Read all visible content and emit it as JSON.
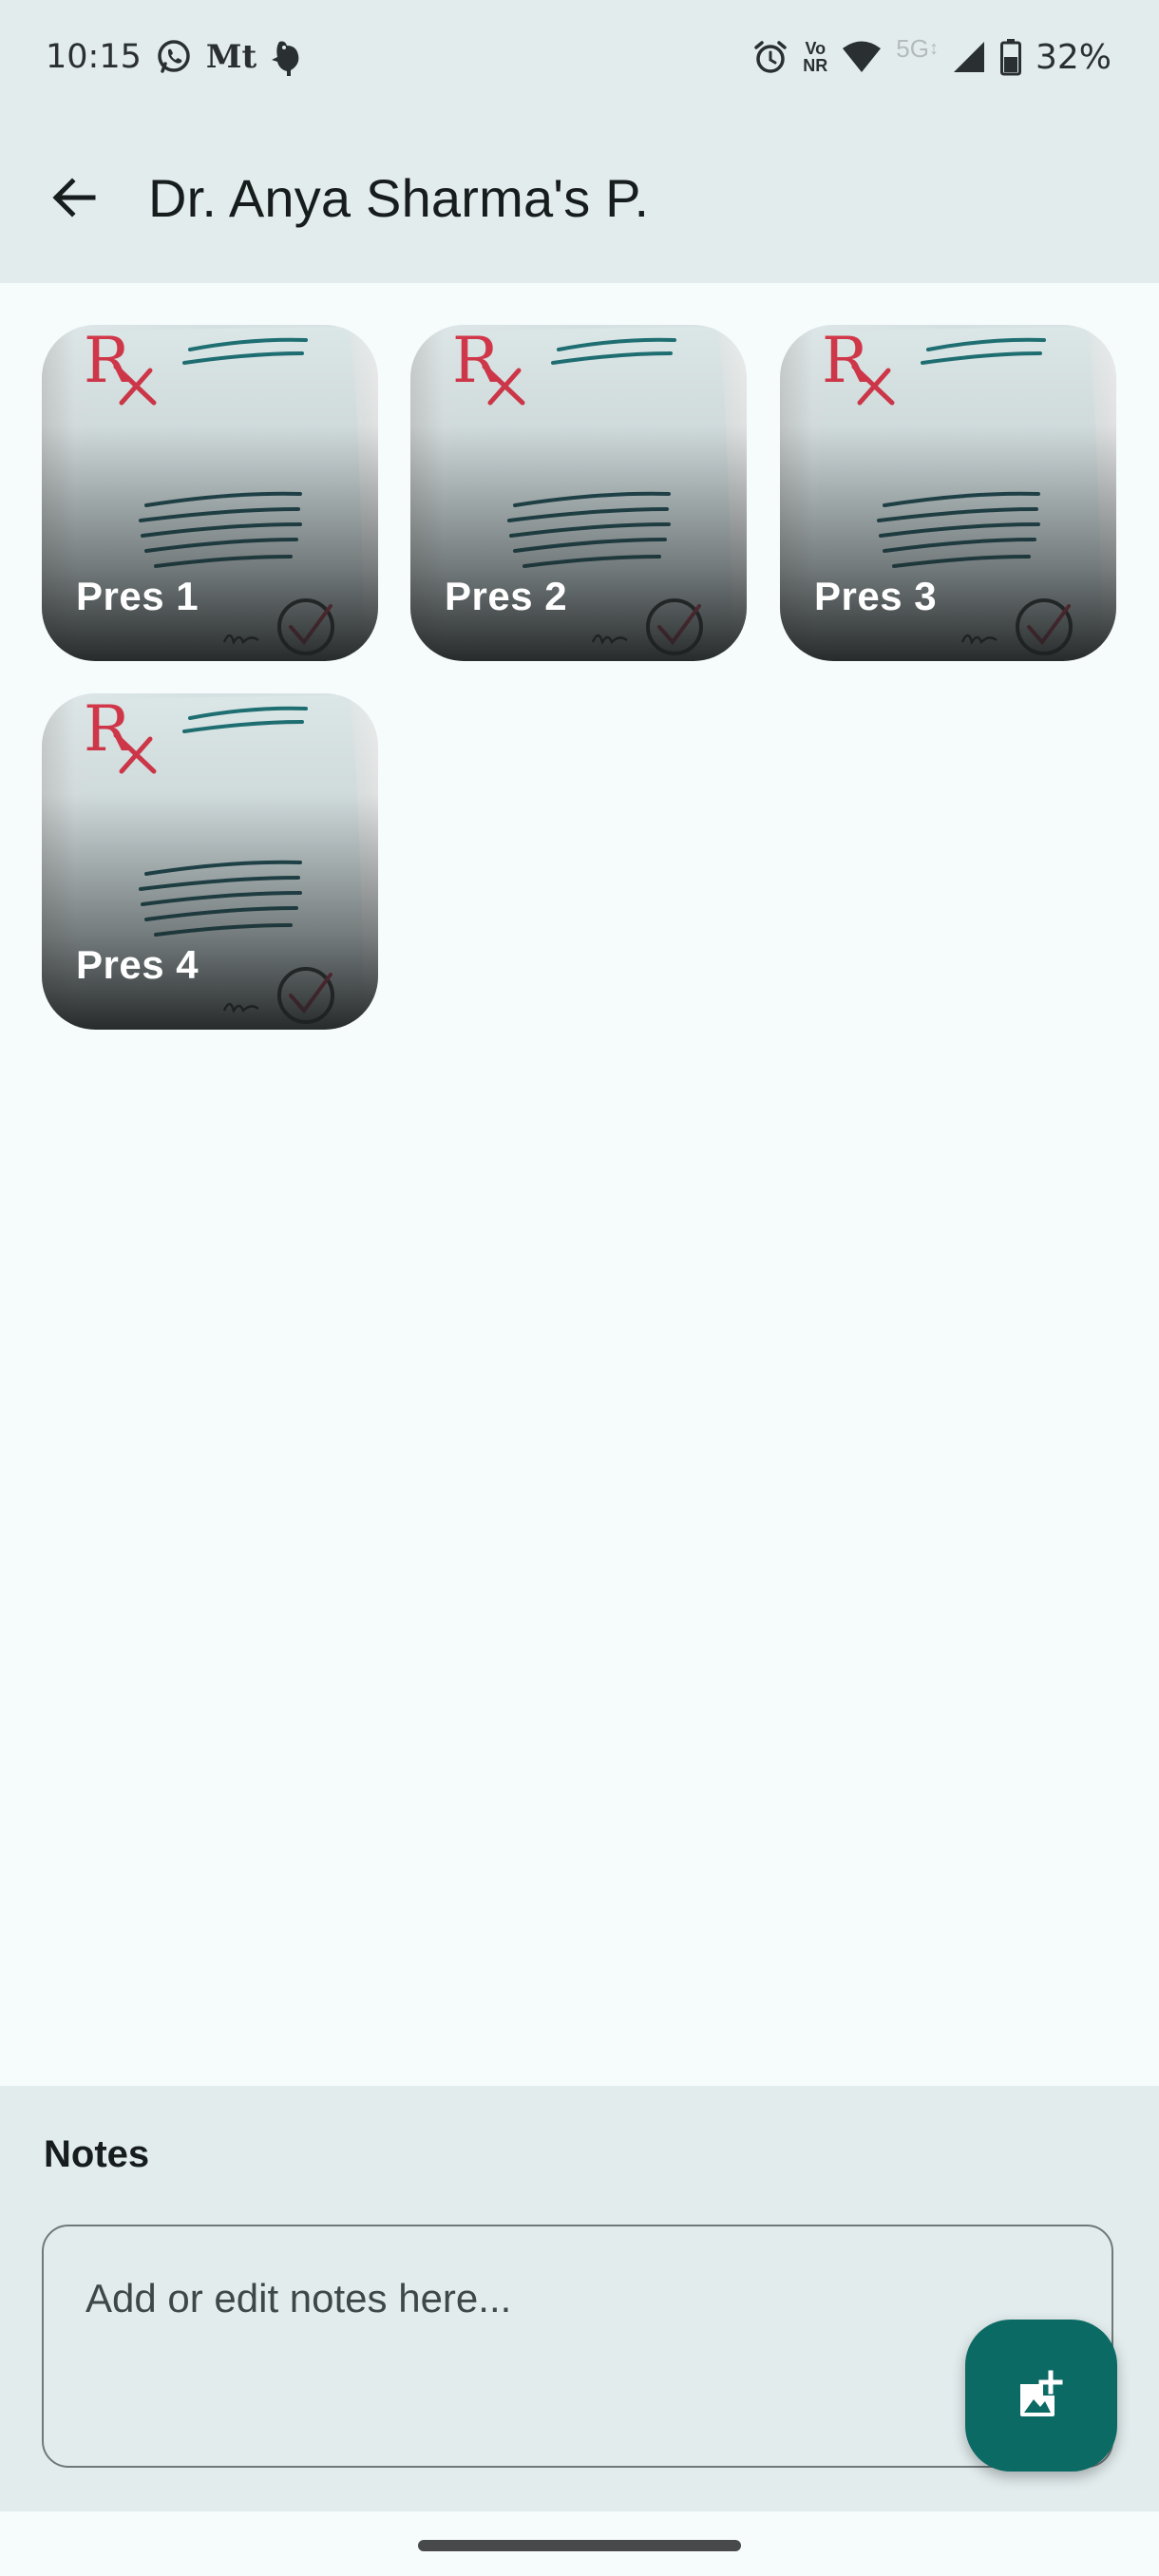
{
  "status_bar": {
    "time": "10:15",
    "carrier_text": "Mt",
    "network_label_top": "Vo",
    "network_label_bottom": "NR",
    "network_type": "5G",
    "battery": "32%",
    "icons": [
      "whatsapp-icon",
      "mail-icon",
      "bird-icon",
      "alarm-icon",
      "volte-icon",
      "wifi-icon",
      "signal-icon",
      "battery-icon"
    ]
  },
  "app_bar": {
    "title": "Dr. Anya Sharma's P.",
    "back_icon": "arrow-back-icon"
  },
  "prescriptions": [
    {
      "label": "Pres 1"
    },
    {
      "label": "Pres 2"
    },
    {
      "label": "Pres 3"
    },
    {
      "label": "Pres 4"
    }
  ],
  "notes": {
    "heading": "Notes",
    "placeholder": "Add or edit notes here..."
  },
  "fab": {
    "icon": "add-photo-icon"
  },
  "colors": {
    "bar_background": "#e2eced",
    "page_background": "#f6fbfc",
    "fab": "#0b6a64",
    "rx_red": "#d2384a"
  }
}
